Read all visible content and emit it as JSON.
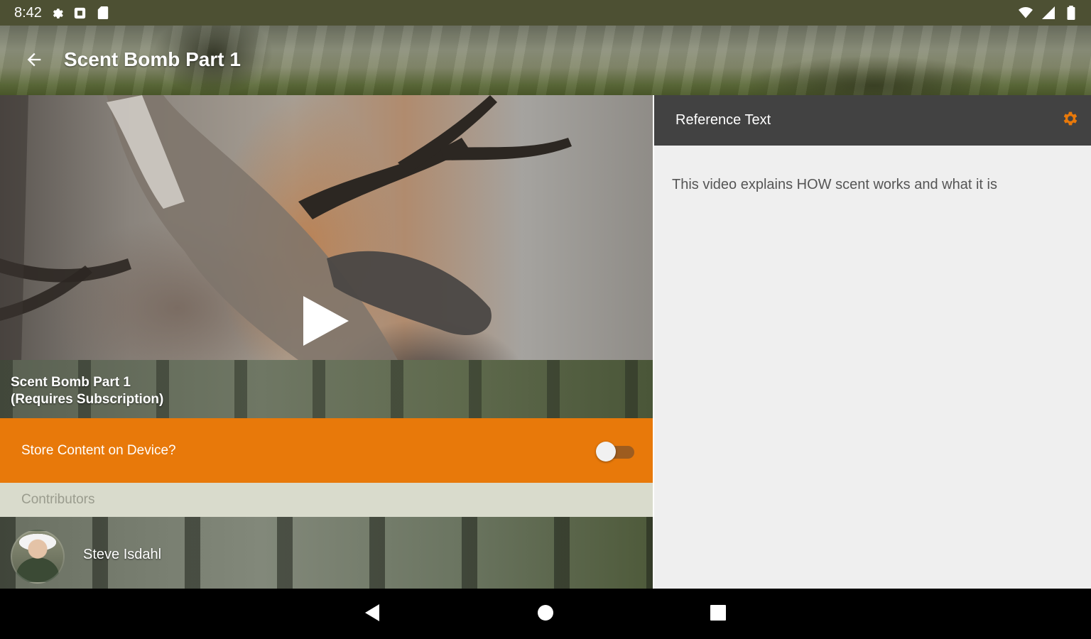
{
  "status_bar": {
    "time": "8:42",
    "left_icons": [
      "gear-icon",
      "record-icon",
      "sd-card-icon"
    ],
    "right_icons": [
      "wifi-icon",
      "cell-signal-icon",
      "battery-icon"
    ]
  },
  "app_bar": {
    "title": "Scent Bomb Part 1",
    "back_icon": "arrow-back-icon"
  },
  "video": {
    "play_icon": "play-icon",
    "title_line1": "Scent Bomb Part 1",
    "title_line2": "(Requires Subscription)"
  },
  "store": {
    "label": "Store Content on Device?",
    "enabled": false
  },
  "contributors": {
    "header": "Contributors",
    "items": [
      {
        "name": "Steve Isdahl"
      }
    ]
  },
  "reference": {
    "title": "Reference Text",
    "settings_icon": "gear-icon",
    "body": "This video explains HOW scent works and what it is"
  },
  "nav_bar": {
    "buttons": [
      "back-triangle-icon",
      "home-circle-icon",
      "recents-square-icon"
    ]
  },
  "colors": {
    "accent_orange": "#e8790a",
    "header_dark": "#424242",
    "status_bar": "#4d5033"
  }
}
